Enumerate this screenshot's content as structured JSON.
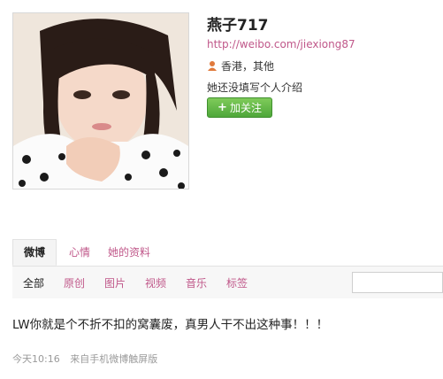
{
  "profile": {
    "name": "燕子717",
    "url": "http://weibo.com/jiexiong87",
    "location": "香港，其他",
    "intro": "她还没填写个人介绍",
    "follow_label": "加关注",
    "follow_plus": "+"
  },
  "tabs": [
    {
      "label": "微博",
      "active": true
    },
    {
      "label": "心情",
      "active": false
    },
    {
      "label": "她的资料",
      "active": false
    }
  ],
  "filters": [
    {
      "label": "全部",
      "active": true
    },
    {
      "label": "原创",
      "active": false
    },
    {
      "label": "图片",
      "active": false
    },
    {
      "label": "视频",
      "active": false
    },
    {
      "label": "音乐",
      "active": false
    },
    {
      "label": "标签",
      "active": false
    }
  ],
  "post": {
    "text": "LW你就是个不折不扣的窝囊废，真男人干不出这种事！！！",
    "time": "今天10:16",
    "source": "来自手机微博触屏版"
  },
  "colors": {
    "link": "#c0588a",
    "follow_green": "#5cb344"
  },
  "icons": {
    "location": "person-location-icon",
    "follow": "plus-icon"
  }
}
